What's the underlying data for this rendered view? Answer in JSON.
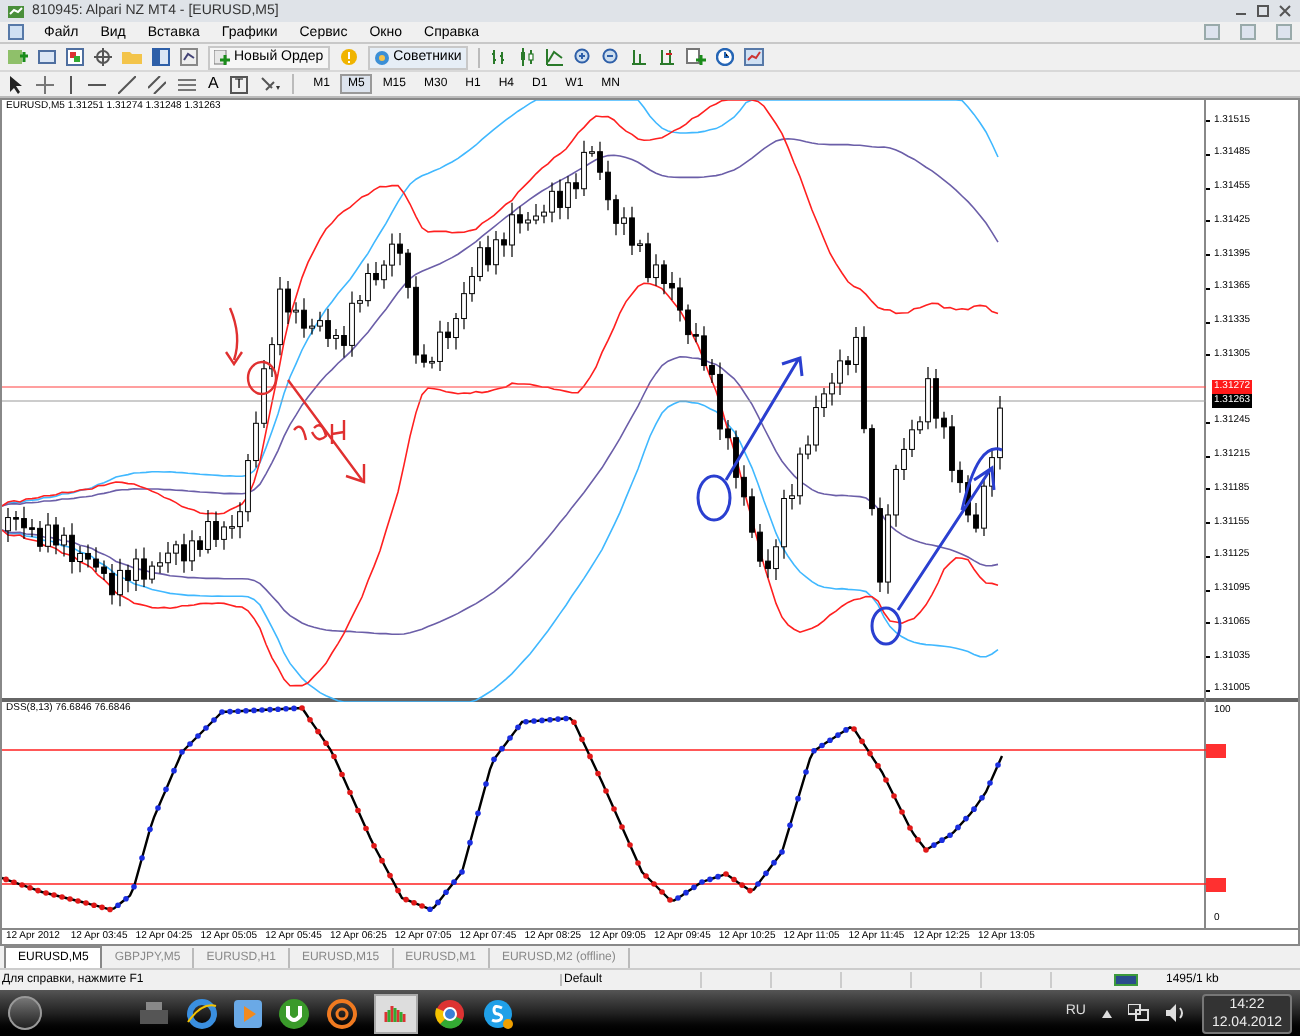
{
  "window": {
    "title": "810945: Alpari NZ MT4 - [EURUSD,M5]"
  },
  "menu": [
    "Файл",
    "Вид",
    "Вставка",
    "Графики",
    "Сервис",
    "Окно",
    "Справка"
  ],
  "toolbar": {
    "buttons": [
      "Новый Ордер",
      "Советники"
    ],
    "tool_glyphs": [
      "A",
      "T"
    ],
    "timeframes": [
      {
        "label": "M1",
        "selected": false
      },
      {
        "label": "M5",
        "selected": true
      },
      {
        "label": "M15",
        "selected": false
      },
      {
        "label": "M30",
        "selected": false
      },
      {
        "label": "H1",
        "selected": false
      },
      {
        "label": "H4",
        "selected": false
      },
      {
        "label": "D1",
        "selected": false
      },
      {
        "label": "W1",
        "selected": false
      },
      {
        "label": "MN",
        "selected": false
      }
    ]
  },
  "chart": {
    "header": "EURUSD,M5  1.31251 1.31274 1.31248 1.31263",
    "price_labels": [
      "1.31515",
      "1.31485",
      "1.31455",
      "1.31425",
      "1.31395",
      "1.31365",
      "1.31335",
      "1.31305",
      "1.31245",
      "1.31215",
      "1.31185",
      "1.31155",
      "1.31125",
      "1.31095",
      "1.31065",
      "1.31035",
      "1.31005"
    ],
    "ask_label": "1.31272",
    "bid_label": "1.31263"
  },
  "indicator": {
    "header": "DSS(8,13) 76.6846 76.6846",
    "top_label": "100",
    "bottom_label": "0"
  },
  "time_labels": [
    "12 Apr 2012",
    "12 Apr 03:45",
    "12 Apr 04:25",
    "12 Apr 05:05",
    "12 Apr 05:45",
    "12 Apr 06:25",
    "12 Apr 07:05",
    "12 Apr 07:45",
    "12 Apr 08:25",
    "12 Apr 09:05",
    "12 Apr 09:45",
    "12 Apr 10:25",
    "12 Apr 11:05",
    "12 Apr 11:45",
    "12 Apr 12:25",
    "12 Apr 13:05"
  ],
  "tabs": [
    {
      "label": "EURUSD,M5",
      "selected": true
    },
    {
      "label": "GBPJPY,M5",
      "selected": false
    },
    {
      "label": "EURUSD,H1",
      "selected": false
    },
    {
      "label": "EURUSD,M15",
      "selected": false
    },
    {
      "label": "EURUSD,M1",
      "selected": false
    },
    {
      "label": "EURUSD,M2 (offline)",
      "selected": false
    }
  ],
  "status_bar": {
    "help": "Для справки, нажмите F1",
    "profile": "Default",
    "traffic": "1495/1 kb"
  },
  "taskbar": {
    "language": "RU",
    "time": "14:22",
    "date": "12.04.2012"
  }
}
